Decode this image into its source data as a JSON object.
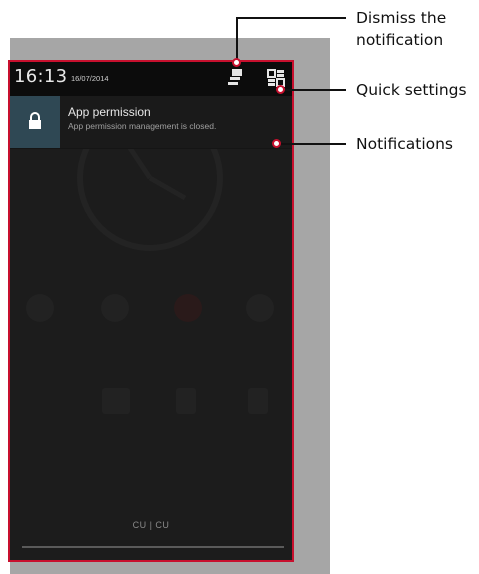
{
  "statusbar": {
    "time": "16:13",
    "date": "16/07/2014",
    "dismiss_icon": "dismiss-all-icon",
    "quick_settings_icon": "quick-settings-icon"
  },
  "notification": {
    "icon": "lock-icon",
    "title": "App permission",
    "text": "App permission management is closed."
  },
  "carrier": {
    "text": "CU | CU"
  },
  "callouts": {
    "dismiss_line1": "Dismiss the",
    "dismiss_line2": "notification",
    "quick_settings": "Quick settings",
    "notifications": "Notifications"
  },
  "colors": {
    "frame_border": "#c8102e",
    "notification_icon_bg": "#2f4854",
    "backdrop": "#a6a6a6"
  }
}
